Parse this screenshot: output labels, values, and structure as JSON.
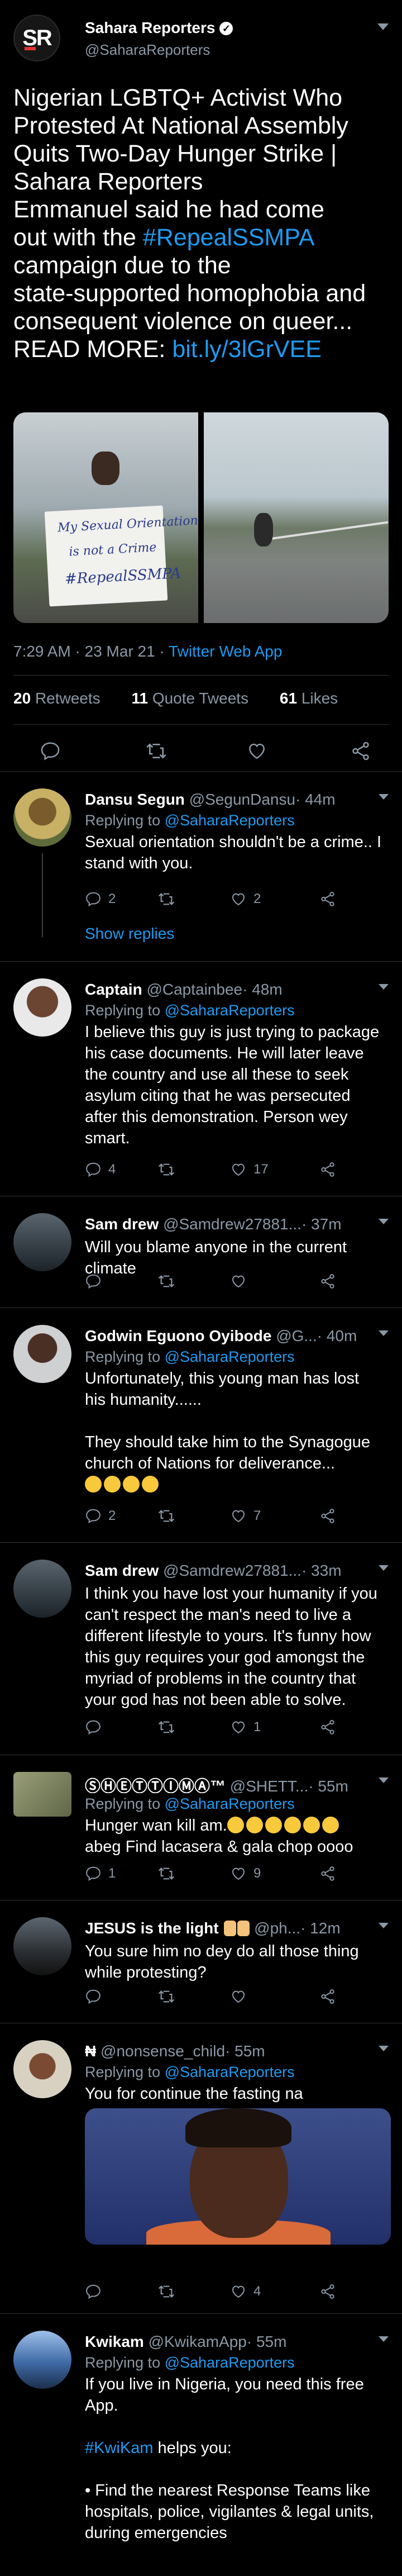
{
  "main_tweet": {
    "author": {
      "avatar_text": "SR",
      "name": "Sahara Reporters",
      "verified_mark": "✓",
      "handle": "@SaharaReporters"
    },
    "text_lines": [
      "Nigerian LGBTQ+ Activist Who",
      "Protested At National Assembly",
      "Quits Two-Day Hunger Strike |",
      "Sahara Reporters"
    ],
    "text_line5_plain": "Emmanuel said he had come",
    "text_line6_prefix": "out with the ",
    "hashtag": "#RepealSSMPA",
    "text_lines_rest": [
      "campaign due to the",
      "state-supported homophobia and",
      "consequent violence on queer..."
    ],
    "read_more_prefix": "READ MORE: ",
    "link": "bit.ly/3lGrVEE",
    "sign_lines": [
      "My Sexual Orientation",
      "is not a Crime",
      "#RepealSSMPA"
    ],
    "timestamp_time": "7:29 AM",
    "timestamp_date": "23 Mar 21",
    "timestamp_sep": " · ",
    "client": "Twitter Web App",
    "stats": {
      "retweets_count": "20",
      "retweets_label": "Retweets",
      "quotes_count": "11",
      "quotes_label": "Quote Tweets",
      "likes_count": "61",
      "likes_label": "Likes"
    },
    "icons": [
      "reply-icon",
      "retweet-icon",
      "like-icon",
      "share-icon"
    ]
  },
  "replies": [
    {
      "name": "Dansu Segun",
      "handle": "@SegunDansu",
      "time": "· 44m",
      "replying_prefix": "Replying to ",
      "replying_to": "@SaharaReporters",
      "text": [
        "Sexual orientation shouldn't be a crime.. I",
        "stand with you."
      ],
      "reply_count": "2",
      "retweet_count": "",
      "like_count": "2",
      "show_replies": "Show replies"
    },
    {
      "name": "Captain",
      "handle": "@Captainbee",
      "time": "· 48m",
      "replying_prefix": "Replying to ",
      "replying_to": "@SaharaReporters",
      "text": [
        "I believe this guy is just trying to package",
        "his case documents. He will later leave",
        "the country and use all these to seek",
        "asylum citing that he was persecuted",
        "after this demonstration. Person wey",
        "smart."
      ],
      "reply_count": "4",
      "retweet_count": "",
      "like_count": "17"
    },
    {
      "name": "Sam drew",
      "handle": "@Samdrew27881...",
      "time": "· 37m",
      "text": [
        "Will you blame anyone in the current",
        "climate"
      ],
      "reply_count": "",
      "retweet_count": "",
      "like_count": ""
    },
    {
      "name": "Godwin Eguono Oyibode",
      "handle": "@G...",
      "time": "· 40m",
      "replying_prefix": "Replying to ",
      "replying_to": "@SaharaReporters",
      "text": [
        "Unfortunately, this young man has lost",
        "his humanity......",
        "",
        "They should take him to the Synagogue",
        "church of Nations for deliverance..."
      ],
      "emoji_line": "🤣😁😁😁",
      "reply_count": "2",
      "retweet_count": "",
      "like_count": "7"
    },
    {
      "name": "Sam drew",
      "handle": "@Samdrew27881...",
      "time": "· 33m",
      "text": [
        "I think you have lost your humanity if you",
        "can't respect the man's need to live a",
        "different lifestyle to yours. It's funny how",
        "this guy requires your god amongst the",
        "myriad of problems in the country that",
        "your god has not been able to solve."
      ],
      "reply_count": "",
      "retweet_count": "",
      "like_count": "1"
    },
    {
      "name": "ⓈⒽⒺⓉⓉⒾⓂⒶ™",
      "handle": "@SHETT...",
      "time": "· 55m",
      "replying_prefix": "Replying to ",
      "replying_to": "@SaharaReporters",
      "text_prefix": "Hunger wan kill am.",
      "emoji_count": 6,
      "text": [
        "abeg Find lacasera & gala chop oooo"
      ],
      "reply_count": "1",
      "retweet_count": "",
      "like_count": "9"
    },
    {
      "name": "JESUS is the light",
      "name_emoji": "🙏🙏",
      "handle": "@ph...",
      "time": "· 12m",
      "text": [
        "You sure him no dey do all those thing",
        "while protesting?"
      ],
      "reply_count": "",
      "retweet_count": "",
      "like_count": ""
    },
    {
      "name": "₦",
      "handle": "@nonsense_child",
      "time": "· 55m",
      "replying_prefix": "Replying to ",
      "replying_to": "@SaharaReporters",
      "text": [
        "You for continue the fasting na"
      ],
      "reply_count": "",
      "retweet_count": "",
      "like_count": "4"
    },
    {
      "name": "Kwikam",
      "handle": "@KwikamApp",
      "time": "· 55m",
      "replying_prefix": "Replying to ",
      "replying_to": "@SaharaReporters",
      "text": [
        "If you live in Nigeria, you need this free",
        "App."
      ],
      "hashtag": "#KwiKam",
      "hashtag_suffix": " helps you:",
      "bullet_lines": [
        "• Find the nearest Response Teams like",
        "hospitals, police, vigilantes & legal units,",
        "during emergencies"
      ]
    }
  ],
  "colors": {
    "accent": "#1d9bf0",
    "muted": "#8b98a5",
    "divider": "#2f3336",
    "background": "#000000"
  }
}
